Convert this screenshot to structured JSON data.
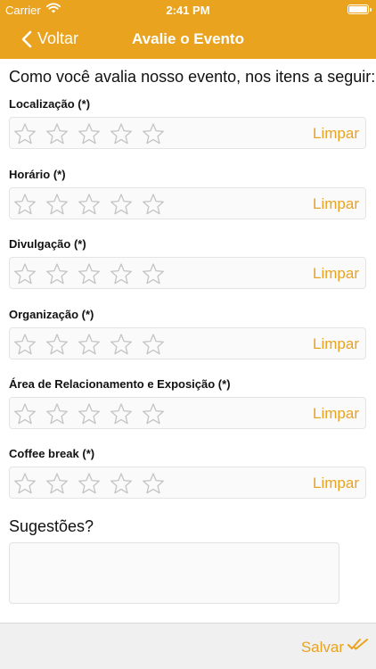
{
  "status_bar": {
    "carrier": "Carrier",
    "time": "2:41 PM"
  },
  "nav": {
    "back_label": "Voltar",
    "title": "Avalie o Evento"
  },
  "question": "Como você avalia nosso evento, nos itens a seguir:",
  "categories": [
    {
      "label": "Localização (*)",
      "clear_label": "Limpar",
      "rating": 0,
      "max": 5
    },
    {
      "label": "Horário (*)",
      "clear_label": "Limpar",
      "rating": 0,
      "max": 5
    },
    {
      "label": "Divulgação  (*)",
      "clear_label": "Limpar",
      "rating": 0,
      "max": 5
    },
    {
      "label": "Organização (*)",
      "clear_label": "Limpar",
      "rating": 0,
      "max": 5
    },
    {
      "label": "Área de Relacionamento e Exposição (*)",
      "clear_label": "Limpar",
      "rating": 0,
      "max": 5
    },
    {
      "label": "Coffee break (*)",
      "clear_label": "Limpar",
      "rating": 0,
      "max": 5
    }
  ],
  "suggestions": {
    "label": "Sugestões?",
    "value": ""
  },
  "footer": {
    "save_label": "Salvar"
  },
  "colors": {
    "accent": "#e9a31f",
    "star_outline": "#c4c4c4"
  },
  "icons": {
    "back": "chevron-left-icon",
    "wifi": "wifi-icon",
    "battery": "battery-icon",
    "star": "star-outline-icon",
    "save": "double-check-icon"
  }
}
